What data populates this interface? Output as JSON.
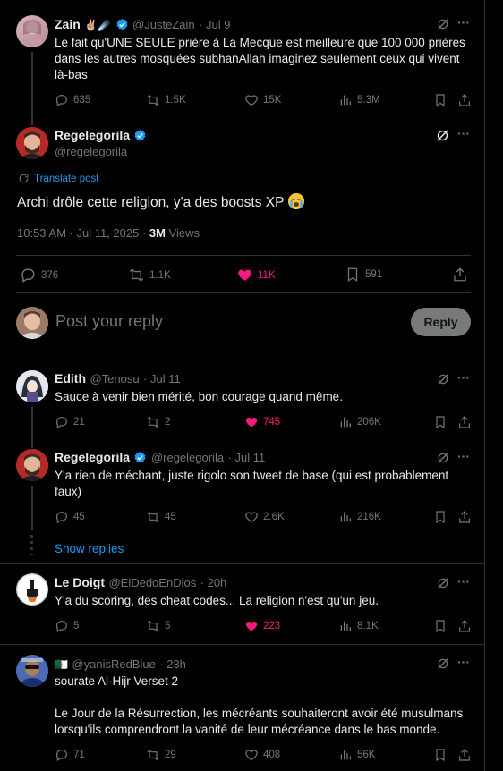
{
  "tweets": {
    "parent": {
      "name": "Zain",
      "name_emojis": "✌🏼☄️",
      "handle": "@JusteZain",
      "time": "· Jul 9",
      "text": "Le fait qu'UNE SEULE prière à La Mecque est meilleure que 100 000 prières dans les autres mosquées subhanAllah imaginez seulement ceux qui vivent là-bas",
      "replies": "635",
      "reposts": "1.5K",
      "likes": "15K",
      "views": "5.3M"
    },
    "main": {
      "name": "Regelegorila",
      "handle": "@regelegorila",
      "translate": "Translate post",
      "text": "Archi drôle cette religion, y'a des boosts XP",
      "timestamp": "10:53 AM · Jul 11, 2025 · ",
      "views_count": "3M",
      "views_label": " Views",
      "replies": "376",
      "reposts": "1.1K",
      "likes": "11K",
      "bookmarks": "591"
    },
    "composer": {
      "placeholder": "Post your reply",
      "button": "Reply"
    },
    "edith": {
      "name": "Edith",
      "handle": "@Tenosu",
      "time": "· Jul 11",
      "text": "Sauce à venir bien mérité, bon courage quand même.",
      "replies": "21",
      "reposts": "2",
      "likes": "745",
      "views": "206K"
    },
    "rege_reply": {
      "name": "Regelegorila",
      "handle": "@regelegorila",
      "time": "· Jul 11",
      "text": "Y'a rien de méchant, juste rigolo son tweet de base (qui est probablement faux)",
      "replies": "45",
      "reposts": "45",
      "likes": "2.6K",
      "views": "216K"
    },
    "show_replies": "Show replies",
    "doigt": {
      "name": "Le Doigt",
      "handle": "@ElDedoEnDios",
      "time": "· 20h",
      "text": "Y'a du scoring, des cheat codes... La religion n'est qu'un jeu.",
      "replies": "5",
      "reposts": "5",
      "likes": "223",
      "views": "8.1K"
    },
    "yanis": {
      "flag": "🇩🇿",
      "handle": "@yanisRedBlue",
      "time": "· 23h",
      "text1": "sourate Al-Hijr Verset 2",
      "text2": "Le Jour de la Résurrection, les mécréants souhaiteront avoir été musulmans lorsqu'ils comprendront la vanité de leur mécréance dans le bas monde.",
      "replies": "71",
      "reposts": "29",
      "likes": "408",
      "views": "56K"
    }
  },
  "colors": {
    "accent": "#1d9bf0",
    "like": "#f91880",
    "muted": "#71767b",
    "text": "#e7e9ea",
    "border": "#2f3336"
  }
}
